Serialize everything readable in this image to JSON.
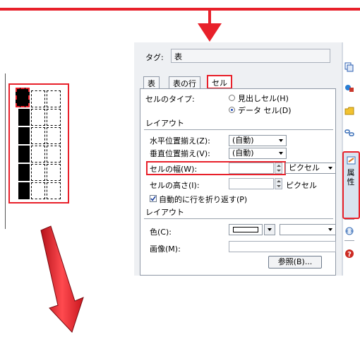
{
  "panel": {
    "tag_label": "タグ:",
    "tag_value": "表",
    "tabs": [
      "表",
      "表の行",
      "セル"
    ],
    "cell_type_label": "セルのタイプ:",
    "radio_header": "見出しセル(H)",
    "radio_data": "データ セル(D)",
    "section_layout": "レイアウト",
    "halign_label": "水平位置揃え(Z):",
    "halign_value": "(自動)",
    "valign_label": "垂直位置揃え(V):",
    "valign_value": "(自動)",
    "width_label": "セルの幅(W):",
    "width_unit": "ピクセル",
    "height_label": "セルの高さ(I):",
    "height_unit": "ピクセル",
    "wrap_label": "自動的に行を折り返す(P)",
    "section_layout2": "レイアウト",
    "color_label": "色(C):",
    "image_label": "画像(M):",
    "browse_button": "参照(B)..."
  },
  "sidebar": {
    "properties_tab": "属性",
    "icons": [
      "copy-icon",
      "objects-icon",
      "folder-icon",
      "link-icon",
      "properties-icon",
      "embed-icon",
      "help-icon"
    ]
  },
  "colors": {
    "accent_red": "#e8202a",
    "help_red": "#cc2a22"
  }
}
